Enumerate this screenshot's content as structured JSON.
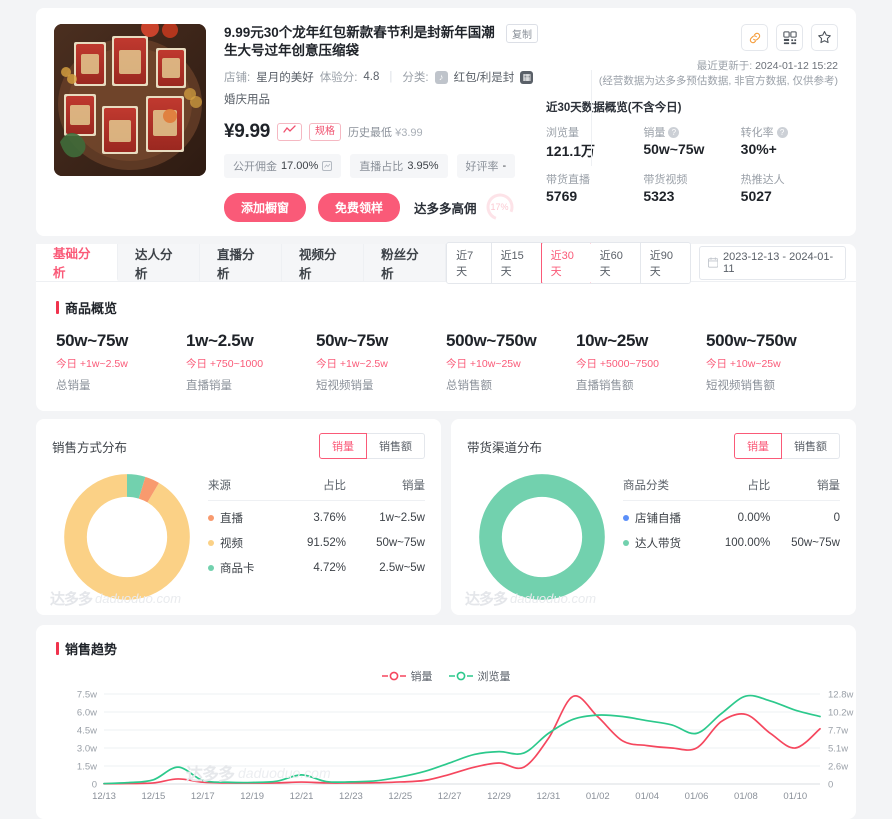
{
  "product": {
    "title": "9.99元30个龙年红包新款春节利是封新年国潮生大号过年创意压缩袋",
    "copy_label": "复制",
    "shop_label": "店铺:",
    "shop_name": "星月的美好",
    "exp_label": "体验分:",
    "exp_value": "4.8",
    "cat_label": "分类:",
    "cat1": "红包/利是封",
    "cat2": "婚庆用品",
    "price": "¥9.99",
    "spec_btn": "规格",
    "history_low_label": "历史最低",
    "history_low_value": "¥3.99",
    "tags": [
      {
        "label": "公开佣金",
        "value": "17.00%"
      },
      {
        "label": "直播占比",
        "value": "3.95%"
      },
      {
        "label": "好评率",
        "value": "-"
      }
    ],
    "cta_primary": "添加橱窗",
    "cta_secondary": "免费领样",
    "high_commission": "达多多高佣",
    "gauge_text": "17%"
  },
  "header_right": {
    "updated_label": "最近更新于:",
    "updated_value": "2024-01-12 15:22",
    "disclaimer": "(经营数据为达多多预估数据, 非官方数据, 仅供参考)",
    "overview_title": "近30天数据概览(不含今日)",
    "metrics": [
      {
        "label": "浏览量",
        "value": "121.1万",
        "help": false
      },
      {
        "label": "销量",
        "value": "50w~75w",
        "help": true
      },
      {
        "label": "转化率",
        "value": "30%+",
        "help": true
      },
      {
        "label": "带货直播",
        "value": "5769",
        "help": false
      },
      {
        "label": "带货视频",
        "value": "5323",
        "help": false
      },
      {
        "label": "热推达人",
        "value": "5027",
        "help": false
      }
    ]
  },
  "tabs": [
    {
      "label": "基础分析",
      "active": true
    },
    {
      "label": "达人分析",
      "active": false
    },
    {
      "label": "直播分析",
      "active": false
    },
    {
      "label": "视频分析",
      "active": false
    },
    {
      "label": "粉丝分析",
      "active": false
    }
  ],
  "ranges": [
    {
      "label": "近7天",
      "active": false
    },
    {
      "label": "近15天",
      "active": false
    },
    {
      "label": "近30天",
      "active": true
    },
    {
      "label": "近60天",
      "active": false
    },
    {
      "label": "近90天",
      "active": false
    }
  ],
  "date_picker": "2023-12-13 - 2024-01-11",
  "overview": {
    "title": "商品概览",
    "stats": [
      {
        "value": "50w~75w",
        "today_label": "今日",
        "delta": "+1w~2.5w",
        "name": "总销量"
      },
      {
        "value": "1w~2.5w",
        "today_label": "今日",
        "delta": "+750~1000",
        "name": "直播销量"
      },
      {
        "value": "50w~75w",
        "today_label": "今日",
        "delta": "+1w~2.5w",
        "name": "短视频销量"
      },
      {
        "value": "500w~750w",
        "today_label": "今日",
        "delta": "+10w~25w",
        "name": "总销售额"
      },
      {
        "value": "10w~25w",
        "today_label": "今日",
        "delta": "+5000~7500",
        "name": "直播销售额"
      },
      {
        "value": "500w~750w",
        "today_label": "今日",
        "delta": "+10w~25w",
        "name": "短视频销售额"
      }
    ]
  },
  "watermark": {
    "brand": "达多多",
    "domain": "daduoduo.com"
  },
  "dist_left": {
    "title": "销售方式分布",
    "segments": [
      {
        "label": "销量",
        "active": true
      },
      {
        "label": "销售额",
        "active": false
      }
    ],
    "columns": [
      "来源",
      "占比",
      "销量"
    ],
    "rows": [
      {
        "name": "直播",
        "pct": "3.76%",
        "value": "1w~2.5w",
        "color": "#f89a6e"
      },
      {
        "name": "视频",
        "pct": "91.52%",
        "value": "50w~75w",
        "color": "#fbd186"
      },
      {
        "name": "商品卡",
        "pct": "4.72%",
        "value": "2.5w~5w",
        "color": "#72d1ae"
      }
    ]
  },
  "dist_right": {
    "title": "带货渠道分布",
    "segments": [
      {
        "label": "销量",
        "active": true
      },
      {
        "label": "销售额",
        "active": false
      }
    ],
    "columns": [
      "商品分类",
      "占比",
      "销量"
    ],
    "rows": [
      {
        "name": "店铺自播",
        "pct": "0.00%",
        "value": "0",
        "color": "#5b8ff9"
      },
      {
        "name": "达人带货",
        "pct": "100.00%",
        "value": "50w~75w",
        "color": "#72d1ae"
      }
    ]
  },
  "trend": {
    "title": "销售趋势",
    "legend": [
      {
        "label": "销量",
        "color": "#f5475e"
      },
      {
        "label": "浏览量",
        "color": "#2cc98c"
      }
    ]
  },
  "chart_data": {
    "type": "line",
    "title": "销售趋势",
    "x": [
      "12/13",
      "12/14",
      "12/15",
      "12/16",
      "12/17",
      "12/18",
      "12/19",
      "12/20",
      "12/21",
      "12/22",
      "12/23",
      "12/24",
      "12/25",
      "12/26",
      "12/27",
      "12/28",
      "12/29",
      "12/30",
      "12/31",
      "01/01",
      "01/02",
      "01/03",
      "01/04",
      "01/05",
      "01/06",
      "01/07",
      "01/08",
      "01/09",
      "01/10",
      "01/11"
    ],
    "xtick_labels": [
      "12/13",
      "12/15",
      "12/17",
      "12/19",
      "12/21",
      "12/23",
      "12/25",
      "12/27",
      "12/29",
      "12/31",
      "01/02",
      "01/04",
      "01/06",
      "01/08",
      "01/10"
    ],
    "grid": true,
    "legend_position": "top-center",
    "axes": {
      "left": {
        "label": "销量",
        "ticks": [
          "0",
          "1.5w",
          "3.0w",
          "4.5w",
          "6.0w",
          "7.5w"
        ],
        "tick_values": [
          0,
          15000,
          30000,
          45000,
          60000,
          75000
        ],
        "ylim": [
          0,
          75000
        ]
      },
      "right": {
        "label": "浏览量",
        "ticks": [
          "0",
          "2.6w",
          "5.1w",
          "7.7w",
          "10.2w",
          "12.8w"
        ],
        "tick_values": [
          0,
          26000,
          51000,
          77000,
          102000,
          128000
        ],
        "ylim": [
          0,
          128000
        ]
      }
    },
    "series": [
      {
        "name": "销量",
        "color": "#f5475e",
        "axis": "left",
        "values": [
          200,
          400,
          900,
          4200,
          1500,
          900,
          800,
          900,
          1600,
          900,
          900,
          1100,
          1700,
          3000,
          8000,
          14000,
          17500,
          14000,
          38000,
          73000,
          56000,
          36000,
          32000,
          30000,
          30000,
          52000,
          58000,
          42000,
          30000,
          46000
        ]
      },
      {
        "name": "浏览量",
        "color": "#2cc98c",
        "axis": "right",
        "values": [
          600,
          2000,
          6000,
          24000,
          5000,
          2500,
          2200,
          4000,
          13000,
          3500,
          3000,
          4500,
          10000,
          18000,
          30000,
          42000,
          46000,
          44000,
          72000,
          92000,
          98000,
          96000,
          90000,
          84000,
          72000,
          100000,
          125000,
          118000,
          105000,
          96000
        ]
      }
    ]
  }
}
